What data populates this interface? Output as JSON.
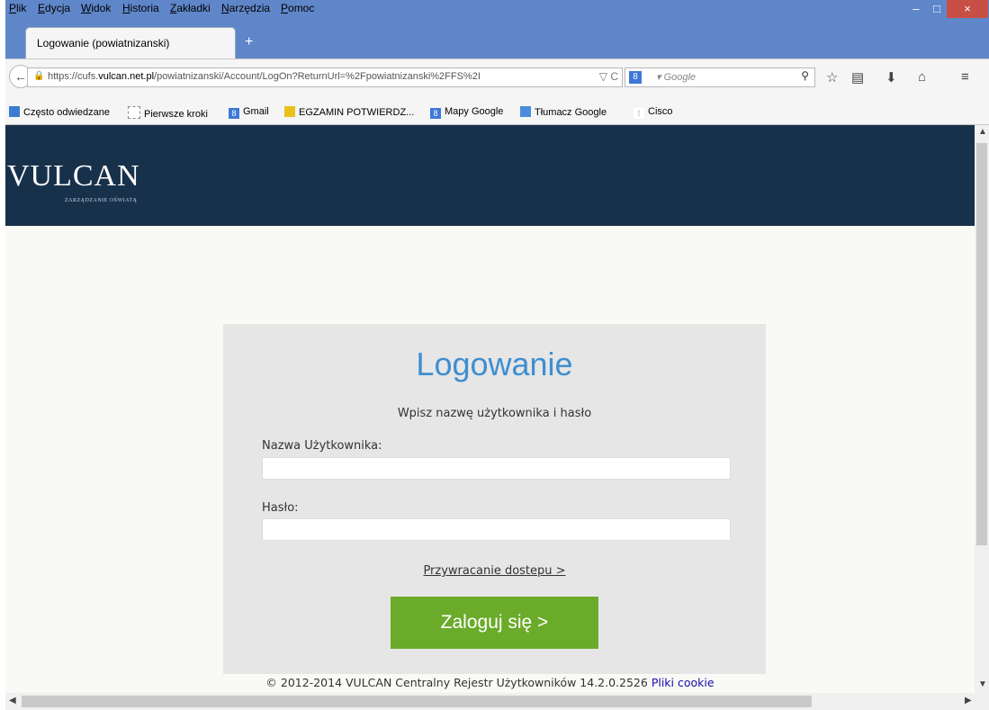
{
  "window": {
    "menu": [
      "Plik",
      "Edycja",
      "Widok",
      "Historia",
      "Zakładki",
      "Narzędzia",
      "Pomoc"
    ],
    "minimize": "–",
    "maximize": "□",
    "close": "×"
  },
  "tab": {
    "title": "Logowanie (powiatnizanski)",
    "new_tab": "+"
  },
  "nav": {
    "back": "←",
    "url_prefix": "https://cufs.",
    "url_domain": "vulcan.net.pl",
    "url_path": "/powiatnizanski/Account/LogOn?ReturnUrl=%2Fpowiatnizanski%2FFS%2I",
    "url_controls": "▽ C",
    "search_engine": "8",
    "search_placeholder": "▾ Google",
    "search_icon": "⚲",
    "star": "☆",
    "reading": "▤",
    "download": "⬇",
    "home": "⌂",
    "menu": "≡"
  },
  "bookmarks": [
    "Często odwiedzane",
    "Pierwsze kroki",
    "Gmail",
    "EGZAMIN POTWIERDZ...",
    "Mapy Google",
    "Tłumacz Google",
    "Cisco"
  ],
  "page": {
    "logo": "VULCAN",
    "logo_sub": "ZARZĄDZANIE OŚWIATĄ",
    "title": "Logowanie",
    "subtitle": "Wpisz nazwę użytkownika i hasło",
    "username_label": "Nazwa Użytkownika:",
    "username_value": "",
    "password_label": "Hasło:",
    "password_value": "",
    "recover_link": "Przywracanie dostepu >",
    "login_button": "Zaloguj się >",
    "footer_text": "© 2012-2014 VULCAN Centralny Rejestr Użytkowników 14.2.0.2526",
    "footer_link": "Pliki cookie"
  },
  "colors": {
    "header": "#18314b",
    "title": "#3e8ed0",
    "button": "#6aab2a",
    "window": "#5f86c9"
  }
}
